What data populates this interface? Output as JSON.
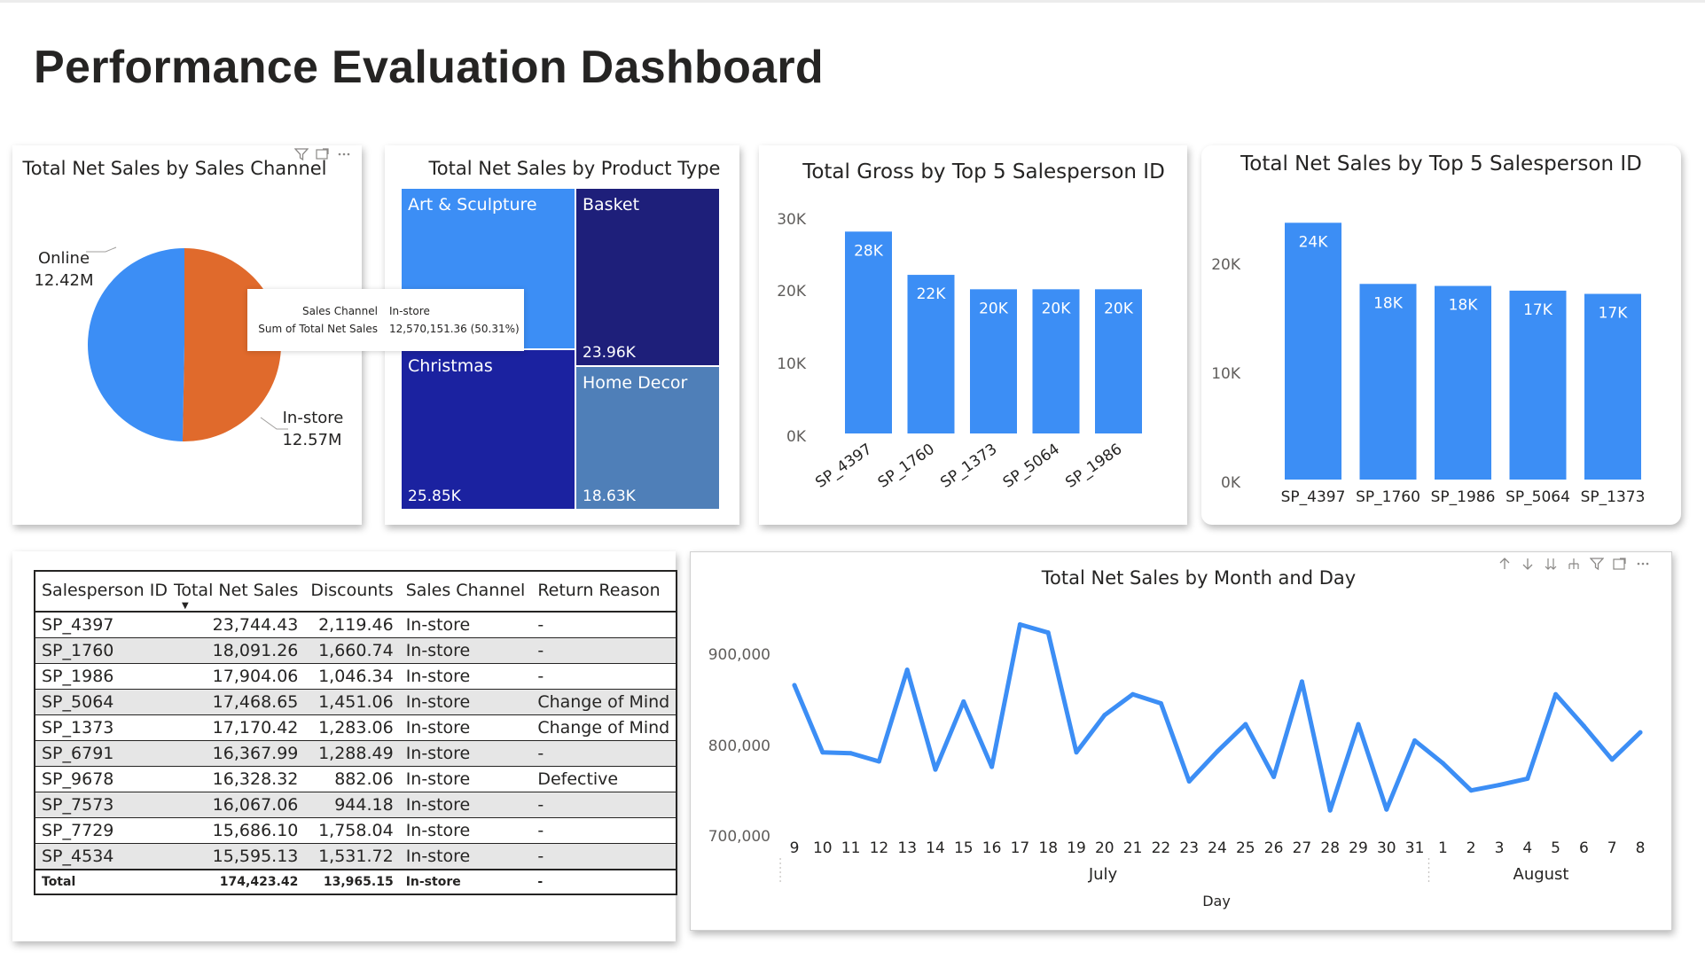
{
  "page": {
    "title": "Performance Evaluation Dashboard"
  },
  "pie": {
    "title": "Total Net Sales by Sales Channel",
    "slices": [
      {
        "label": "In-store",
        "value_label": "12.57M",
        "value": 12570151.36,
        "color": "#E06A2C"
      },
      {
        "label": "Online",
        "value_label": "12.42M",
        "value": 12420000,
        "color": "#3C8EF5"
      }
    ],
    "tooltip": {
      "field1_label": "Sales Channel",
      "field1_value": "In-store",
      "field2_label": "Sum of Total Net Sales",
      "field2_value": "12,570,151.36 (50.31%)"
    },
    "icons": [
      "filter-icon",
      "expand-icon",
      "more-icon"
    ]
  },
  "treemap": {
    "title": "Total Net Sales by Product Type",
    "cells": [
      {
        "label": "Art & Sculpture",
        "value_label": "",
        "color": "#3C8EF5"
      },
      {
        "label": "Basket",
        "value_label": "23.96K",
        "color": "#1E1F7A"
      },
      {
        "label": "Christmas",
        "value_label": "25.85K",
        "color": "#1B22A0"
      },
      {
        "label": "Home Decor",
        "value_label": "18.63K",
        "color": "#4F7FB8"
      }
    ]
  },
  "gross_chart": {
    "title": "Total Gross by Top 5 Salesperson ID",
    "y_ticks": [
      "30K",
      "20K",
      "10K",
      "0K"
    ]
  },
  "net_top5_chart": {
    "title": "Total Net Sales by Top 5 Salesperson ID",
    "y_ticks": [
      "20K",
      "10K",
      "0K"
    ]
  },
  "line_chart": {
    "title": "Total Net Sales by Month and Day",
    "x_axis_title": "Day",
    "y_ticks": [
      "900,000",
      "800,000",
      "700,000"
    ],
    "months": [
      "July",
      "August"
    ],
    "icons": [
      "sort-ascending-icon",
      "sort-descending-icon",
      "expand-down-icon",
      "drill-icon",
      "filter-icon",
      "focus-icon",
      "more-icon"
    ]
  },
  "table": {
    "columns": [
      "Salesperson ID",
      "Total Net Sales",
      "Discounts",
      "Sales Channel",
      "Return Reason"
    ],
    "rows": [
      [
        "SP_4397",
        "23,744.43",
        "2,119.46",
        "In-store",
        "-"
      ],
      [
        "SP_1760",
        "18,091.26",
        "1,660.74",
        "In-store",
        "-"
      ],
      [
        "SP_1986",
        "17,904.06",
        "1,046.34",
        "In-store",
        "-"
      ],
      [
        "SP_5064",
        "17,468.65",
        "1,451.06",
        "In-store",
        "Change of Mind"
      ],
      [
        "SP_1373",
        "17,170.42",
        "1,283.06",
        "In-store",
        "Change of Mind"
      ],
      [
        "SP_6791",
        "16,367.99",
        "1,288.49",
        "In-store",
        "-"
      ],
      [
        "SP_9678",
        "16,328.32",
        "882.06",
        "In-store",
        "Defective"
      ],
      [
        "SP_7573",
        "16,067.06",
        "944.18",
        "In-store",
        "-"
      ],
      [
        "SP_7729",
        "15,686.10",
        "1,758.04",
        "In-store",
        "-"
      ],
      [
        "SP_4534",
        "15,595.13",
        "1,531.72",
        "In-store",
        "-"
      ]
    ],
    "total": [
      "Total",
      "174,423.42",
      "13,965.15",
      "In-store",
      "-"
    ]
  },
  "chart_data": [
    {
      "type": "pie",
      "title": "Total Net Sales by Sales Channel",
      "categories": [
        "In-store",
        "Online"
      ],
      "values": [
        12570151.36,
        12420000
      ],
      "labels": [
        "12.57M",
        "12.42M"
      ]
    },
    {
      "type": "treemap",
      "title": "Total Net Sales by Product Type",
      "categories": [
        "Christmas",
        "Art & Sculpture",
        "Basket",
        "Home Decor"
      ],
      "values": [
        25850,
        24000,
        23960,
        18630
      ],
      "labels": [
        "25.85K",
        "",
        "23.96K",
        "18.63K"
      ]
    },
    {
      "type": "bar",
      "title": "Total Gross by Top 5 Salesperson ID",
      "categories": [
        "SP_4397",
        "SP_1760",
        "SP_1373",
        "SP_5064",
        "SP_1986"
      ],
      "values": [
        28000,
        22000,
        20000,
        20000,
        20000
      ],
      "labels": [
        "28K",
        "22K",
        "20K",
        "20K",
        "20K"
      ],
      "ylim": [
        0,
        30000
      ],
      "color": "#3C8EF5"
    },
    {
      "type": "bar",
      "title": "Total Net Sales by Top 5 Salesperson ID",
      "categories": [
        "SP_4397",
        "SP_1760",
        "SP_1986",
        "SP_5064",
        "SP_1373"
      ],
      "values": [
        23744.43,
        18091.26,
        17904.06,
        17468.65,
        17170.42
      ],
      "labels": [
        "24K",
        "18K",
        "18K",
        "17K",
        "17K"
      ],
      "ylim": [
        0,
        25000
      ],
      "color": "#3C8EF5"
    },
    {
      "type": "line",
      "title": "Total Net Sales by Month and Day",
      "xlabel": "Day",
      "x": [
        "9",
        "10",
        "11",
        "12",
        "13",
        "14",
        "15",
        "16",
        "17",
        "18",
        "19",
        "20",
        "21",
        "22",
        "23",
        "24",
        "25",
        "26",
        "27",
        "28",
        "29",
        "30",
        "31",
        "1",
        "2",
        "3",
        "4",
        "5",
        "6",
        "7",
        "8"
      ],
      "month_groups": [
        {
          "name": "July",
          "days": 23
        },
        {
          "name": "August",
          "days": 8
        }
      ],
      "series": [
        {
          "values": [
            863000,
            789000,
            788000,
            779000,
            880000,
            770000,
            845000,
            773000,
            930000,
            921000,
            789000,
            830000,
            853000,
            843000,
            757000,
            790000,
            820000,
            762000,
            867000,
            725000,
            820000,
            726000,
            802000,
            777000,
            747000,
            753000,
            760000,
            853000,
            818000,
            781000,
            811000
          ]
        }
      ],
      "ylim": [
        670000,
        950000
      ],
      "yticks": [
        700000,
        800000,
        900000
      ],
      "color": "#3C8EF5"
    }
  ]
}
